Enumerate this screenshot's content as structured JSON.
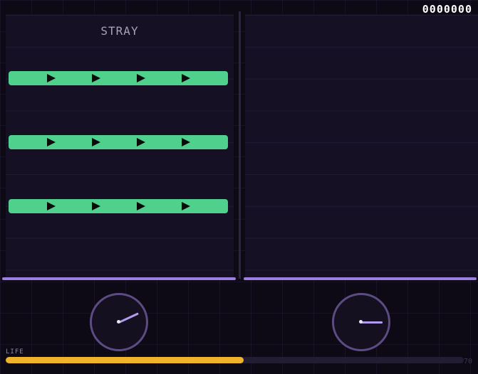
{
  "hud": {
    "score": "0000000",
    "life_label": "LIFE",
    "life_value": "70",
    "life_fraction": 0.52
  },
  "lanes": [
    {
      "label": "STRAY",
      "dial_angle_deg": -25,
      "notes": [
        {
          "type": "hold",
          "direction": "right",
          "arrow_count": 4
        },
        {
          "type": "hold",
          "direction": "right",
          "arrow_count": 4
        },
        {
          "type": "hold",
          "direction": "right",
          "arrow_count": 4
        }
      ]
    },
    {
      "label": "",
      "dial_angle_deg": 0,
      "notes": []
    }
  ],
  "colors": {
    "background": "#0d0a16",
    "lane": "#151023",
    "note": "#4fd08c",
    "hit_line": "#9a7ee0",
    "dial_ring": "#5d4c84",
    "dial_hand": "#b39cf0",
    "life_fill": "#f0b42a",
    "score": "#ffffff"
  },
  "icons": {
    "note_arrow": "play-arrow-icon"
  }
}
